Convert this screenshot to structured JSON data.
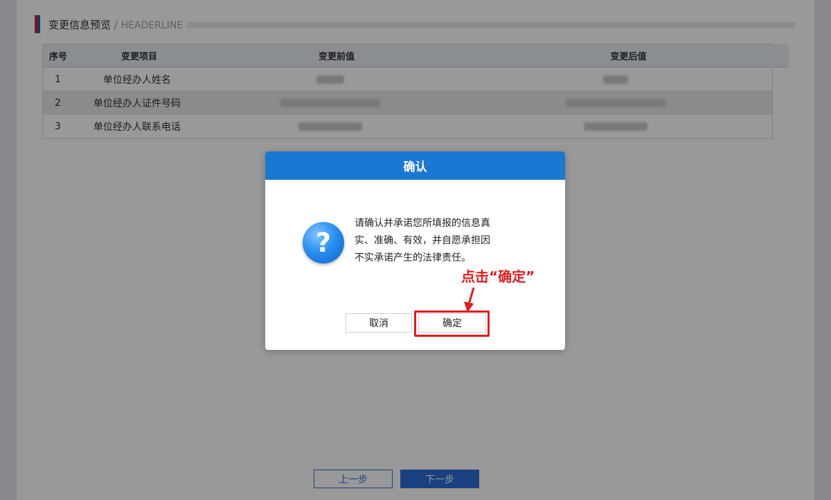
{
  "section": {
    "title": "变更信息预览",
    "separator": "/",
    "subtitle": "HEADERLINE"
  },
  "table": {
    "headers": [
      "序号",
      "变更项目",
      "变更前值",
      "变更后值"
    ],
    "rows": [
      {
        "no": "1",
        "item": "单位经办人姓名"
      },
      {
        "no": "2",
        "item": "单位经办人证件号码"
      },
      {
        "no": "3",
        "item": "单位经办人联系电话"
      }
    ]
  },
  "bottom_buttons": {
    "prev": "上一步",
    "next": "下一步"
  },
  "dialog": {
    "title": "确认",
    "message": "请确认并承诺您所填报的信息真实、准确、有效，并自愿承担因不实承诺产生的法律责任。",
    "cancel": "取消",
    "ok": "确定"
  },
  "annotation": {
    "text": "点击“确定”",
    "color": "#e21b1b"
  },
  "colors": {
    "dialog_header": "#1a78d2",
    "primary_button": "#2d6bd6"
  },
  "icons": {
    "dialog": "question-icon"
  }
}
